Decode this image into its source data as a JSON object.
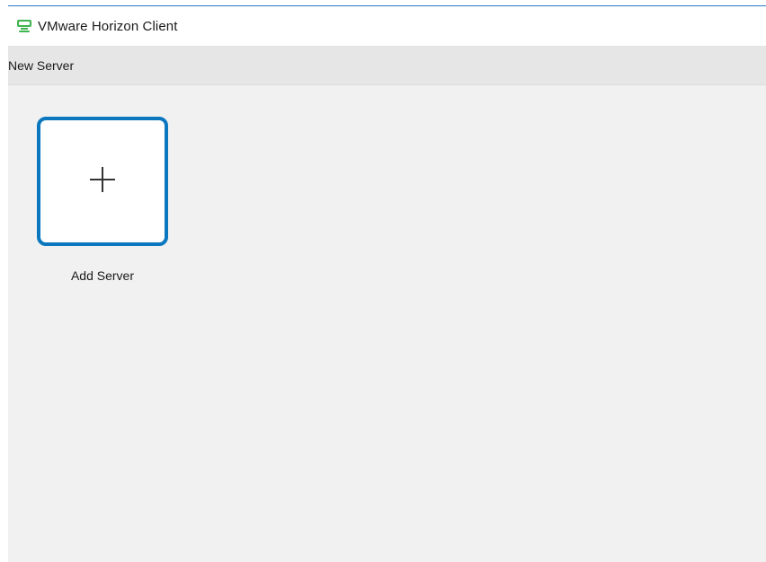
{
  "window": {
    "title": "VMware Horizon Client",
    "icon": "vmware-horizon-logo-icon",
    "accent_color": "#0a77bf",
    "icon_color": "#3fb34f"
  },
  "toolbar": {
    "label": "New Server"
  },
  "main": {
    "tiles": [
      {
        "label": "Add Server",
        "icon": "plus-icon",
        "glyph": "+"
      }
    ]
  }
}
